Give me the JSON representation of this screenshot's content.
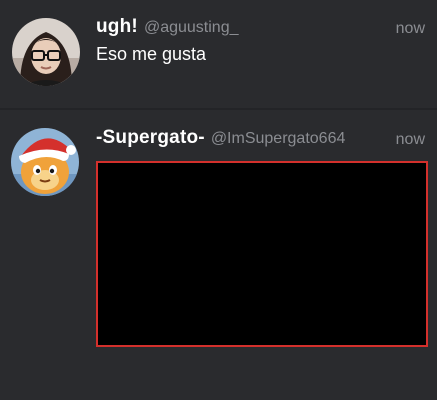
{
  "colors": {
    "background": "#2a2b2e",
    "name_text": "#ffffff",
    "secondary_text": "#8b8d92",
    "media_border": "#d4302c"
  },
  "tweets": [
    {
      "display_name": "ugh!",
      "handle": "@aguusting_",
      "time": "now",
      "text": "Eso me gusta",
      "avatar_icon": "avatar-girl-glasses"
    },
    {
      "display_name": "-Supergato-",
      "handle": "@ImSupergato664",
      "time": "now",
      "avatar_icon": "avatar-santa-cartoon",
      "media": "black-video-frame"
    }
  ]
}
